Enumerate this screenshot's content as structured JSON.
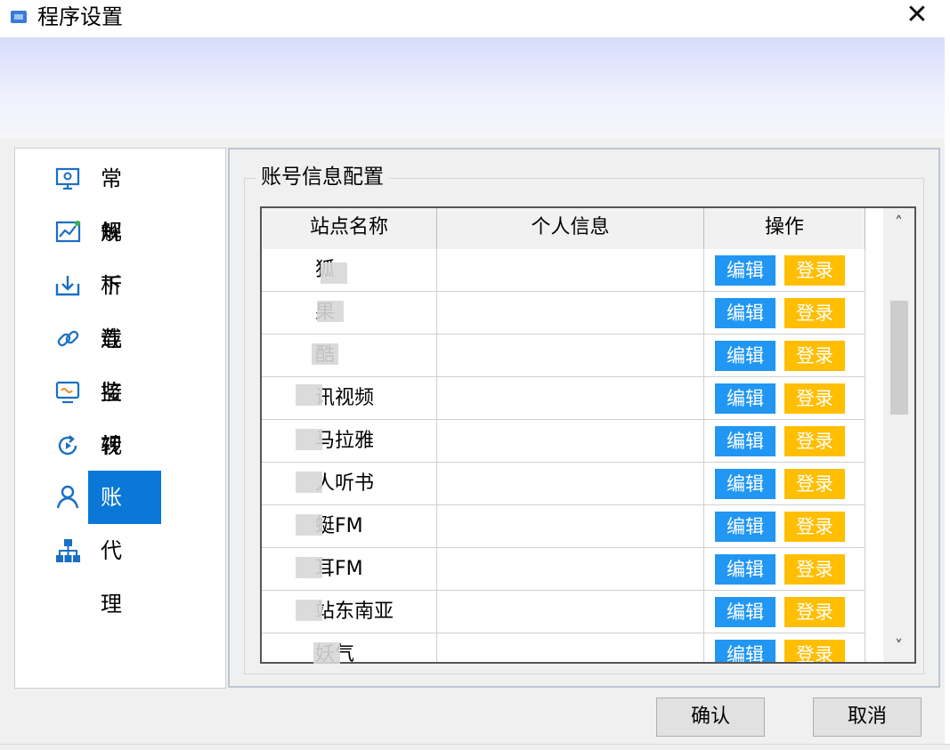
{
  "window": {
    "title": "程序设置",
    "close_symbol": "✕"
  },
  "nav": {
    "items": [
      {
        "label": "常规",
        "icon": "monitor-gear-icon"
      },
      {
        "label": "解析",
        "icon": "chart-icon"
      },
      {
        "label": "下载",
        "icon": "download-icon"
      },
      {
        "label": "连接",
        "icon": "link-icon"
      },
      {
        "label": "监视",
        "icon": "screen-monitor-icon"
      },
      {
        "label": "转码",
        "icon": "refresh-icon"
      },
      {
        "label": "账户",
        "icon": "user-icon",
        "active": true
      },
      {
        "label": "代理",
        "icon": "network-icon"
      }
    ]
  },
  "group": {
    "title": "账号信息配置"
  },
  "table": {
    "headers": [
      "站点名称",
      "个人信息",
      "操作"
    ],
    "edit_label": "编辑",
    "login_label": "登录",
    "rows": [
      {
        "name": "狐",
        "info": ""
      },
      {
        "name": "果",
        "info": ""
      },
      {
        "name": "酷",
        "info": ""
      },
      {
        "name": "讯视频",
        "info": ""
      },
      {
        "name": "马拉雅",
        "info": ""
      },
      {
        "name": "人听书",
        "info": ""
      },
      {
        "name": "蜓FM",
        "info": ""
      },
      {
        "name": "耳FM",
        "info": ""
      },
      {
        "name": "站东南亚",
        "info": ""
      },
      {
        "name": "妖气",
        "info": ""
      }
    ]
  },
  "scrollbar": {
    "up": "˄",
    "down": "˅"
  },
  "footer": {
    "confirm_label": "确认",
    "cancel_label": "取消"
  },
  "colors": {
    "accent": "#0b78d7",
    "edit": "#2196f3",
    "login": "#ffbe00"
  }
}
